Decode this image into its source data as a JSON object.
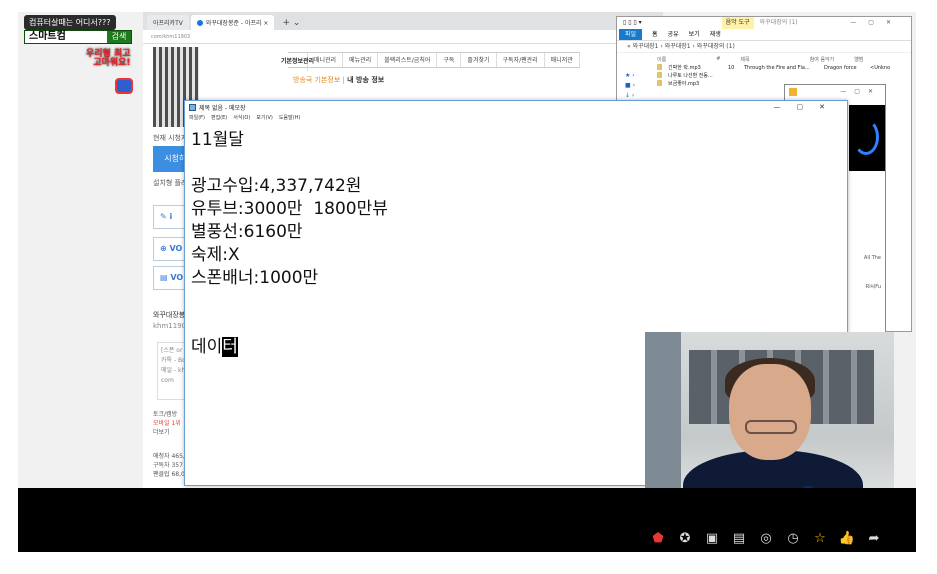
{
  "overlay": {
    "title": "컴퓨터살때는 어디서???",
    "search_text": "스마트컴",
    "search_button": "검색",
    "sticker_line1": "우리형 최고",
    "sticker_line2": "고마워요!"
  },
  "browser": {
    "tabs": [
      "아프리카TV",
      "와꾸대장봉준 - 아프리 ×"
    ],
    "address": "com/khm11903",
    "nav": [
      "기본정보관리",
      "매니관리",
      "메뉴관리",
      "블랙리스트/금칙어",
      "구독",
      "즐겨찾기",
      "구독자/팬관리",
      "매니저관"
    ],
    "breadcrumb_prefix": "방송국 기본정보 |",
    "breadcrumb_current": "내 방송 정보",
    "side_viewers": "현재 시청자수",
    "watch_button": "시청하기",
    "side_install": "설치형 플레이",
    "side_voc1": "VO",
    "side_voc2": "VOI",
    "profile_name": "와꾸대장봉",
    "profile_id": "khm11903",
    "card_lines": [
      "[스폰 or 광",
      "카톡 - Bon",
      "메일 - khm",
      "com"
    ],
    "rank_lines": [
      "토크/캠방",
      "모바일 1위",
      "더보기"
    ],
    "stats_lines": [
      "애청자 465,9",
      "구독자 357 명",
      "팬클럽 68,05"
    ]
  },
  "explorer": {
    "title_tool": "음악 도구",
    "title_path": "와꾸대장의 (1)",
    "ribbon": [
      "파일",
      "홈",
      "공유",
      "보기",
      "재생"
    ],
    "path": "« 와꾸대장1 › 와꾸대장1 › 와꾸대장의 (1)",
    "columns": [
      "이름",
      "#",
      "제목",
      "참여 음악가",
      "앨범"
    ],
    "files": [
      {
        "name": "긴박한 락.mp3",
        "num": "10",
        "title": "Through the Fire and Fla...",
        "artist": "Dragon force",
        "album": "<Unkno"
      },
      {
        "name": "나루토 나선환 전동...",
        "num": "",
        "title": "",
        "artist": "",
        "album": ""
      },
      {
        "name": "브금좋아.mp3",
        "num": "",
        "title": "",
        "artist": "",
        "album": ""
      }
    ]
  },
  "popup": {
    "side_text1": "All The",
    "side_text2": "Ri씨Fu"
  },
  "notepad": {
    "title": "제목 없음 - 메모장",
    "menu": [
      "파일(F)",
      "편집(E)",
      "서식(O)",
      "보기(V)",
      "도움말(H)"
    ],
    "lines": [
      "11월달",
      "",
      "광고수입:4,337,742원",
      "유투브:3000만  1800만뷰",
      "별풍선:6160만",
      "숙제:X",
      "스폰배너:1000만",
      "",
      "",
      ""
    ],
    "last_line_plain": "데이",
    "last_line_selected": "터"
  },
  "actions": {
    "icons": [
      "hot-badge-icon",
      "balloon-icon",
      "clip-icon",
      "grid-icon",
      "gift-icon",
      "clock-icon",
      "star-icon",
      "thumbs-up-icon",
      "share-icon"
    ]
  }
}
